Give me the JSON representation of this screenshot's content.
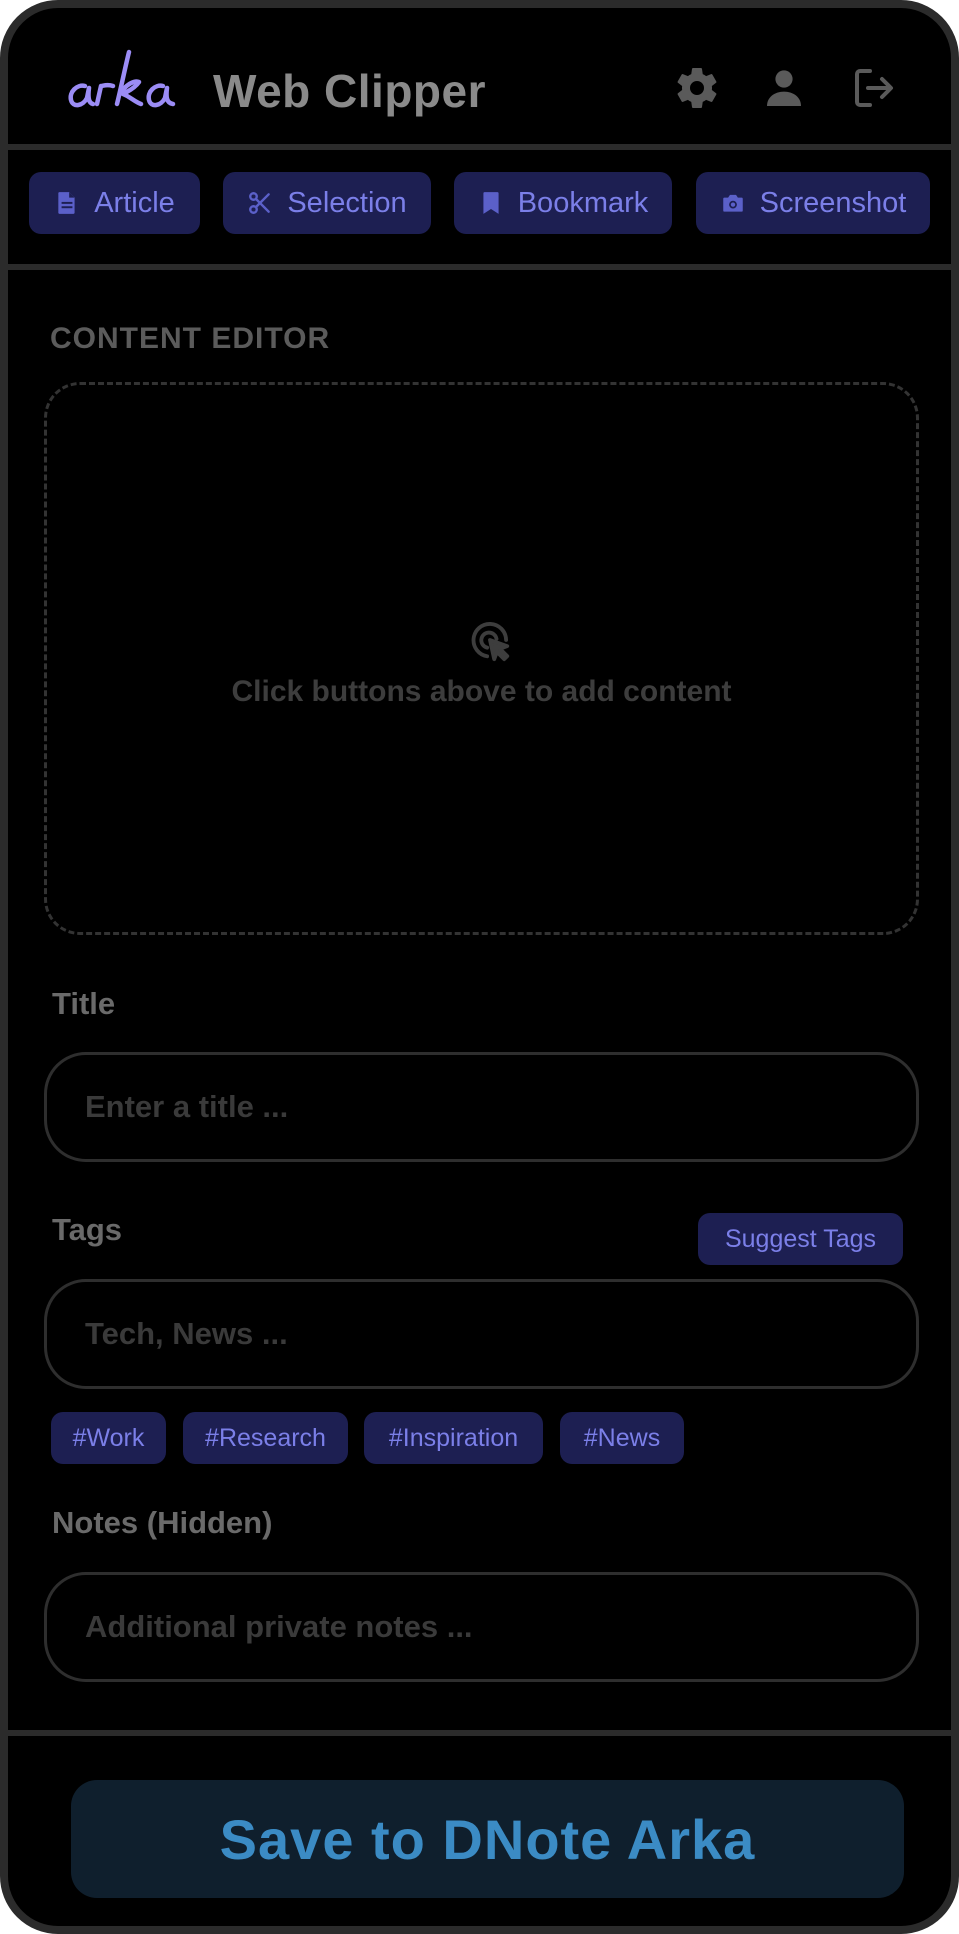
{
  "header": {
    "title": "Web Clipper",
    "logo_icon": "arka-logo",
    "icons": [
      "gear-icon",
      "user-icon",
      "logout-icon"
    ]
  },
  "tabs": [
    {
      "label": "Article",
      "icon": "document-icon"
    },
    {
      "label": "Selection",
      "icon": "scissors-icon"
    },
    {
      "label": "Bookmark",
      "icon": "bookmark-icon"
    },
    {
      "label": "Screenshot",
      "icon": "camera-icon"
    }
  ],
  "editor": {
    "section_label": "CONTENT EDITOR",
    "empty_text": "Click buttons above to add content",
    "empty_icon": "click-cursor-icon"
  },
  "form": {
    "title_label": "Title",
    "title_placeholder": "Enter a title ...",
    "tags_label": "Tags",
    "suggest_tags_label": "Suggest Tags",
    "tags_placeholder": "Tech, News ...",
    "tag_chips": [
      "#Work",
      "#Research",
      "#Inspiration",
      "#News"
    ],
    "notes_label": "Notes (Hidden)",
    "notes_placeholder": "Additional private notes ..."
  },
  "save_button": "Save to DNote Arka",
  "colors": {
    "background": "#000000",
    "frame": "#2b2b2b",
    "accent": "#7b7fe8",
    "accent_bg": "#1d1f52",
    "logo": "#9b8cf5",
    "save_text": "#3b8bc4",
    "save_bg": "#0f1f2d"
  }
}
